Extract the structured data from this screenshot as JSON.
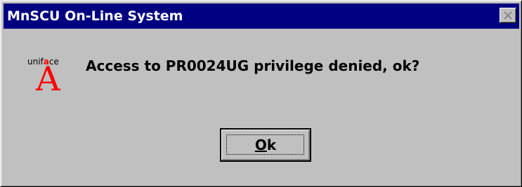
{
  "window": {
    "title": "MnSCU On-Line System",
    "close_icon": "close-icon"
  },
  "logo": {
    "text_prefix": "unif",
    "text_accent": "a",
    "text_suffix": "ce",
    "letter": "A",
    "accent_color": "#ff0000"
  },
  "message": "Access to PR0024UG privilege denied, ok?",
  "ok_button": {
    "mnemonic": "O",
    "rest": "k"
  },
  "colors": {
    "titlebar": "#000080",
    "face": "#c0c0c0"
  }
}
